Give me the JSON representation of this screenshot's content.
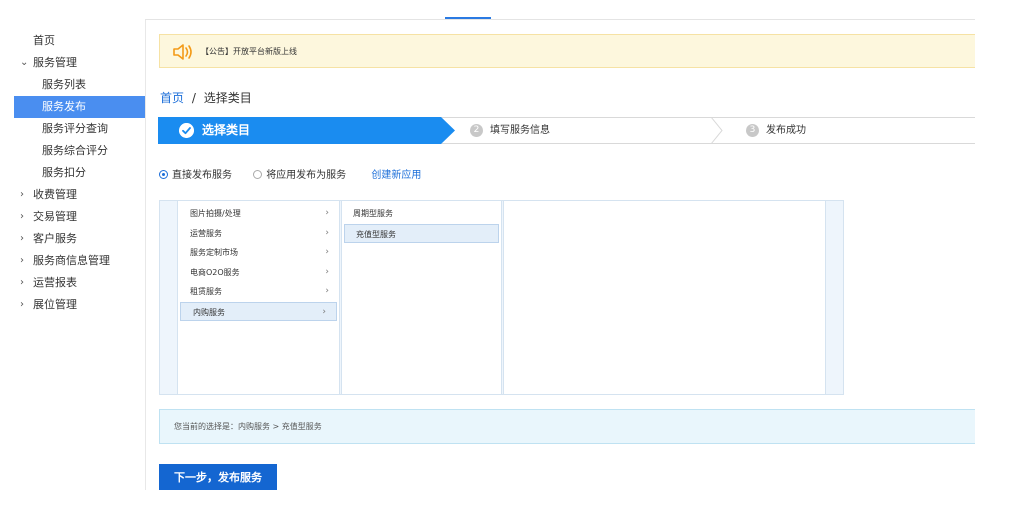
{
  "sidebar": {
    "items": [
      {
        "label": "首页",
        "type": "top"
      },
      {
        "label": "服务管理",
        "type": "group",
        "arrow": "⌄",
        "expanded": true
      },
      {
        "label": "服务列表",
        "type": "sub"
      },
      {
        "label": "服务发布",
        "type": "sub",
        "active": true
      },
      {
        "label": "服务评分查询",
        "type": "sub"
      },
      {
        "label": "服务综合评分",
        "type": "sub"
      },
      {
        "label": "服务扣分",
        "type": "sub"
      },
      {
        "label": "收费管理",
        "type": "group",
        "arrow": "›"
      },
      {
        "label": "交易管理",
        "type": "group",
        "arrow": "›"
      },
      {
        "label": "客户服务",
        "type": "group",
        "arrow": "›"
      },
      {
        "label": "服务商信息管理",
        "type": "group",
        "arrow": "›"
      },
      {
        "label": "运营报表",
        "type": "group",
        "arrow": "›"
      },
      {
        "label": "展位管理",
        "type": "group",
        "arrow": "›"
      }
    ]
  },
  "notice": {
    "icon": "speaker-icon",
    "text": "【公告】开放平台新版上线"
  },
  "breadcrumb": {
    "home": "首页",
    "separator": "/",
    "current": "选择类目"
  },
  "steps": [
    {
      "number": "✓",
      "label": "选择类目",
      "state": "active"
    },
    {
      "number": "2",
      "label": "填写服务信息",
      "state": "pending"
    },
    {
      "number": "3",
      "label": "发布成功",
      "state": "pending"
    }
  ],
  "publish_mode": {
    "options": [
      {
        "label": "直接发布服务",
        "checked": true
      },
      {
        "label": "将应用发布为服务",
        "checked": false
      }
    ],
    "create_link": "创建新应用"
  },
  "categories": {
    "level1": [
      {
        "label": "图片拍摄/处理",
        "arrow": "›"
      },
      {
        "label": "运营服务",
        "arrow": "›"
      },
      {
        "label": "服务定制市场",
        "arrow": "›"
      },
      {
        "label": "电商O2O服务",
        "arrow": "›"
      },
      {
        "label": "租赁服务",
        "arrow": "›"
      },
      {
        "label": "内购服务",
        "arrow": "›",
        "selected": true
      }
    ],
    "level2": [
      {
        "label": "周期型服务"
      },
      {
        "label": "充值型服务",
        "selected": true
      }
    ]
  },
  "selection_summary": "您当前的选择是：内购服务 > 充值型服务",
  "next_button": "下一步，发布服务",
  "colors": {
    "accent": "#1d6fd9",
    "step_active": "#1a8cf0",
    "sidebar_active": "#4a8ef0",
    "notice_bg": "#fdf7dd",
    "summary_bg": "#e9f6fc",
    "button": "#1466d1"
  }
}
